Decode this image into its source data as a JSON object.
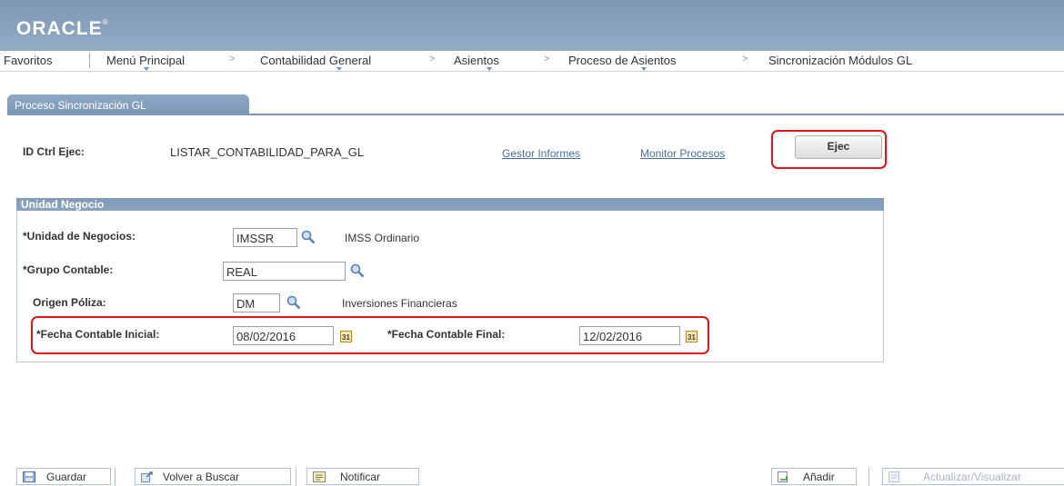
{
  "brand": {
    "logo": "ORACLE"
  },
  "nav": {
    "items": [
      "Favoritos",
      "Menú Principal",
      "Contabilidad General",
      "Asientos",
      "Proceso de Asientos",
      "Sincronización Módulos GL"
    ],
    "separator": ">"
  },
  "tab": {
    "label": "Proceso Sincronización GL"
  },
  "run_control": {
    "label": "ID Ctrl Ejec:",
    "value": "LISTAR_CONTABILIDAD_PARA_GL",
    "link_report_manager": "Gestor Informes",
    "link_process_monitor": "Monitor Procesos",
    "run_button": "Ejec"
  },
  "group": {
    "title": "Unidad Negocio",
    "business_unit": {
      "label": "*Unidad de Negocios:",
      "value": "IMSSR",
      "description": "IMSS Ordinario"
    },
    "ledger_group": {
      "label": "*Grupo Contable:",
      "value": "REAL"
    },
    "journal_source": {
      "label": "Origen Póliza:",
      "value": "DM",
      "description": "Inversiones Financieras"
    },
    "start_date": {
      "label": "*Fecha Contable Inicial:",
      "value": "08/02/2016"
    },
    "end_date": {
      "label": "*Fecha Contable Final:",
      "value": "12/02/2016"
    },
    "calendar_glyph": "31"
  },
  "toolbar": {
    "save": "Guardar",
    "return_to_search": "Volver a Buscar",
    "notify": "Notificar",
    "add": "Añadir",
    "update_display": "Actualizar/Visualizar"
  },
  "colors": {
    "highlight": "#e0141a",
    "banner": "#8aa3bd",
    "link": "#4a6e9a"
  }
}
